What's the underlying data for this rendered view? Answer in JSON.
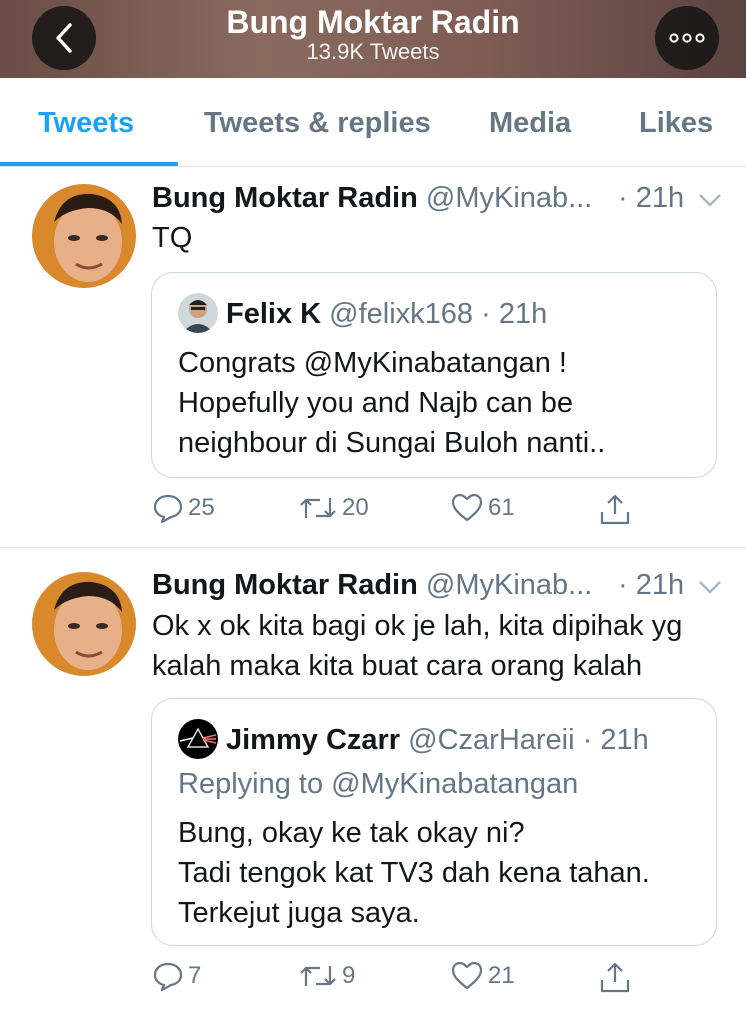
{
  "header": {
    "title": "Bung Moktar Radin",
    "subtitle": "13.9K Tweets",
    "back_icon": "chevron-left-icon",
    "more_icon": "more-icon"
  },
  "tabs": [
    {
      "label": "Tweets",
      "active": true
    },
    {
      "label": "Tweets & replies",
      "active": false
    },
    {
      "label": "Media",
      "active": false
    },
    {
      "label": "Likes",
      "active": false
    }
  ],
  "colors": {
    "accent": "#1da1f2",
    "secondary_text": "#657786",
    "border": "#dfe3e6"
  },
  "tweets": [
    {
      "name": "Bung Moktar Radin",
      "handle": "@MyKinab...",
      "time": "· 21h",
      "text": "TQ",
      "quote": {
        "name": "Felix K",
        "handle": "@felixk168 · 21h",
        "text": "Congrats @MyKinabatangan !\nHopefully you and Najb can be\nneighbour di Sungai Buloh nanti.."
      },
      "actions": {
        "replies": "25",
        "retweets": "20",
        "likes": "61"
      }
    },
    {
      "name": "Bung Moktar Radin",
      "handle": "@MyKinab...",
      "time": "· 21h",
      "text": "Ok x ok kita bagi ok je lah, kita dipihak yg\nkalah maka kita buat cara orang kalah",
      "quote": {
        "name": "Jimmy Czarr",
        "handle": "@CzarHareii · 21h",
        "replying_to": "Replying to @MyKinabatangan",
        "text": "Bung, okay ke tak okay ni?\nTadi tengok kat TV3 dah kena tahan.\nTerkejut juga saya."
      },
      "actions": {
        "replies": "7",
        "retweets": "9",
        "likes": "21"
      }
    }
  ]
}
